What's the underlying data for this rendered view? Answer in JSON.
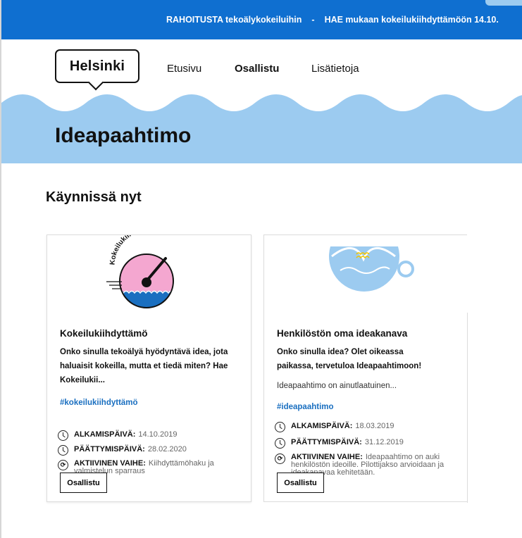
{
  "topbar": {
    "item1": "RAHOITUSTA tekoälykokeiluihin",
    "separator": "-",
    "item2": "HAE mukaan kokeilukiihdyttämöön 14.10."
  },
  "header": {
    "logo_text": "Helsinki",
    "nav": [
      "Etusivu",
      "Osallistu",
      "Lisätietoja"
    ]
  },
  "page": {
    "title": "Ideapaahtimo",
    "section_title": "Käynnissä nyt"
  },
  "cards": [
    {
      "logo_text": "Kokeilukiihdyttämö",
      "title": "Kokeilukiihdyttämö",
      "intro": "Onko sinulla tekoälyä hyödyntävä idea, jota haluaisit kokeilla, mutta et tiedä miten? Hae Kokeilukii...",
      "description": "",
      "tag": "#kokeilukiihdyttämö",
      "start_label": "ALKAMISPÄIVÄ:",
      "start_value": "14.10.2019",
      "end_label": "PÄÄTTYMISPÄIVÄ:",
      "end_value": "28.02.2020",
      "phase_label": "AKTIIVINEN VAIHE:",
      "phase_value": "Kiihdyttämöhaku ja valmistelun sparraus",
      "button": "Osallistu"
    },
    {
      "title": "Henkilöstön oma ideakanava",
      "intro": "Onko sinulla idea? Olet oikeassa paikassa, tervetuloa Ideapaahtimoon!",
      "description": "Ideapaahtimo on ainutlaatuinen...",
      "tag": "#ideapaahtimo",
      "start_label": "ALKAMISPÄIVÄ:",
      "start_value": "18.03.2019",
      "end_label": "PÄÄTTYMISPÄIVÄ:",
      "end_value": "31.12.2019",
      "phase_label": "AKTIIVINEN VAIHE:",
      "phase_value": "Ideapaahtimo on auki henkilöstön ideoille. Pilottijakso arvioidaan ja ideakanavaa kehitetään.",
      "button": "Osallistu"
    }
  ],
  "colors": {
    "topbar": "#0f6fd0",
    "wave": "#9ccbf0",
    "tag": "#1a6fc0",
    "gauge_pink": "#f4a7d0",
    "gauge_blue": "#1a6fc0"
  },
  "icons": [
    "clock-icon",
    "phase-icon",
    "gauge-logo",
    "coffee-cup-logo"
  ]
}
